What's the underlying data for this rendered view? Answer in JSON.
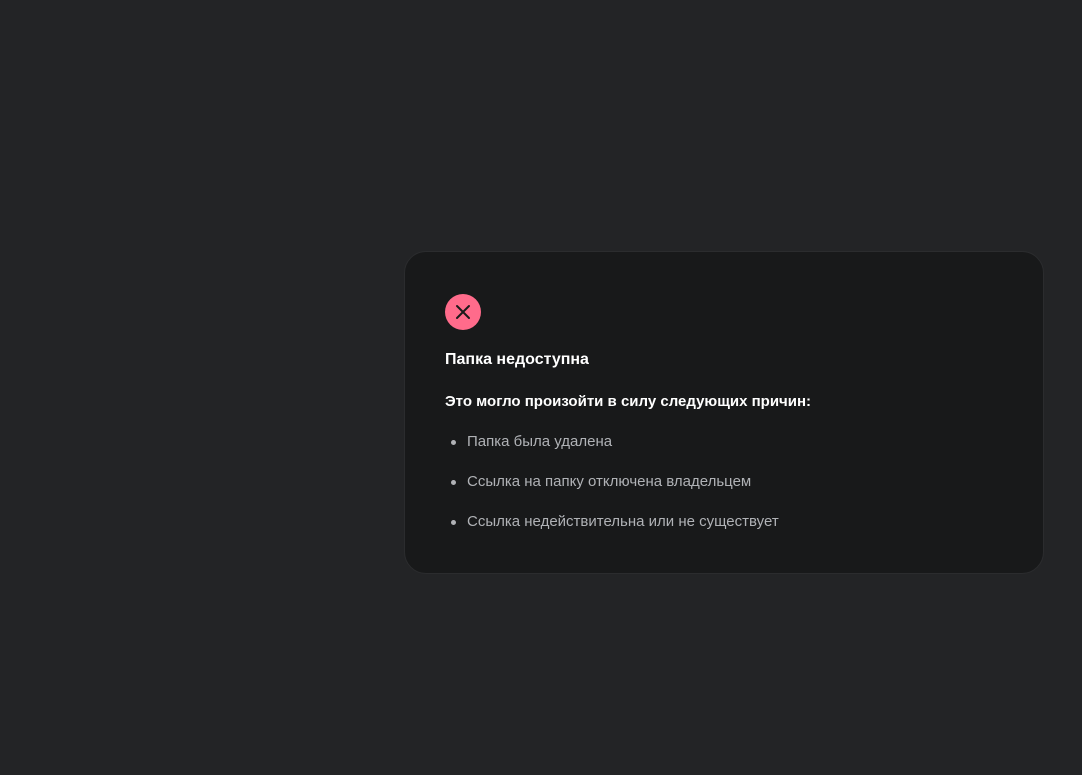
{
  "error_card": {
    "icon": "close-icon",
    "icon_color": "#ff6b8b",
    "title": "Папка недоступна",
    "subtitle": "Это могло произойти в силу следующих причин:",
    "reasons": [
      "Папка была удалена",
      "Ссылка на папку отключена владельцем",
      "Ссылка недействительна или не существует"
    ]
  }
}
